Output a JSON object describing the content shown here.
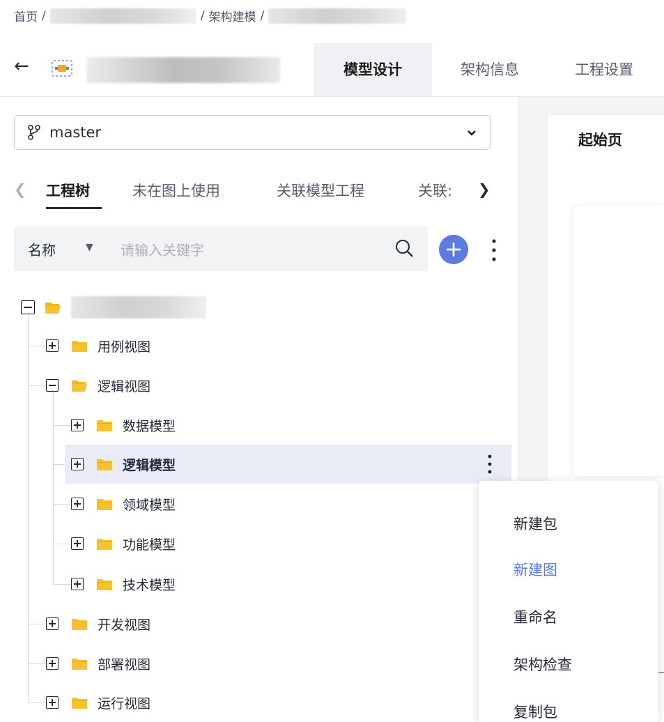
{
  "breadcrumb": {
    "home": "首页",
    "sep": "/",
    "modeling": "架构建模"
  },
  "header": {
    "tabs": [
      {
        "label": "模型设计",
        "active": true
      },
      {
        "label": "架构信息",
        "active": false
      },
      {
        "label": "工程设置",
        "active": false
      }
    ]
  },
  "sidebar": {
    "branch": "master",
    "subtabs": [
      {
        "label": "工程树",
        "active": true
      },
      {
        "label": "未在图上使用",
        "active": false
      },
      {
        "label": "关联模型工程",
        "active": false
      },
      {
        "label": "关联:",
        "active": false
      }
    ],
    "search": {
      "field": "名称",
      "placeholder": "请输入关键字"
    },
    "tree": [
      {
        "label": "用例视图"
      },
      {
        "label": "逻辑视图"
      },
      {
        "label": "数据模型"
      },
      {
        "label": "逻辑模型"
      },
      {
        "label": "领域模型"
      },
      {
        "label": "功能模型"
      },
      {
        "label": "技术模型"
      },
      {
        "label": "开发视图"
      },
      {
        "label": "部署视图"
      },
      {
        "label": "运行视图"
      }
    ]
  },
  "main": {
    "start_tab": "起始页"
  },
  "context_menu": {
    "items": [
      {
        "label": "新建包"
      },
      {
        "label": "新建图"
      },
      {
        "label": "重命名"
      },
      {
        "label": "架构检查"
      },
      {
        "label": "复制包"
      }
    ]
  },
  "colors": {
    "accent": "#5e7ce0",
    "folder": "#f7c22f",
    "highlight": "#e9ebf7"
  }
}
